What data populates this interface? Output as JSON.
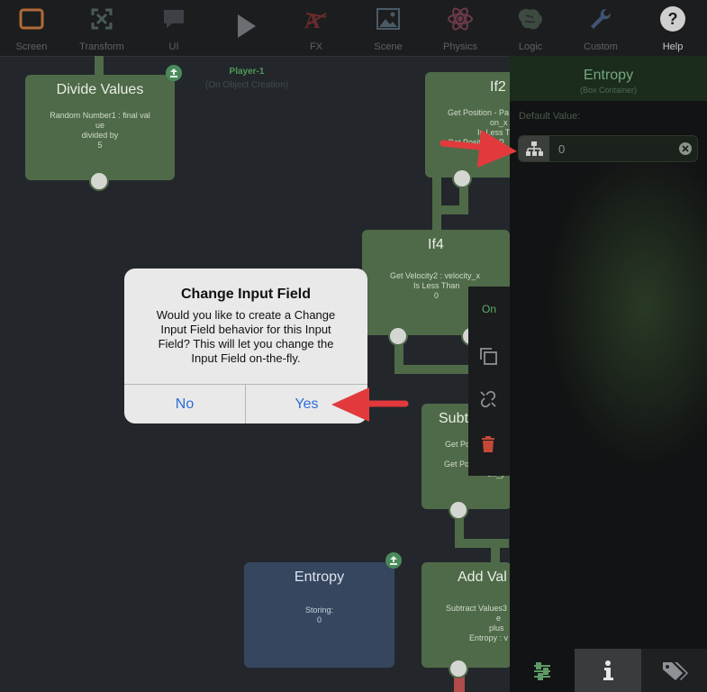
{
  "toolbar": {
    "items": [
      {
        "label": "Screen",
        "icon": "screen-icon"
      },
      {
        "label": "Transform",
        "icon": "transform-icon"
      },
      {
        "label": "UI",
        "icon": "ui-icon"
      },
      {
        "label": "",
        "icon": "play-icon"
      },
      {
        "label": "FX",
        "icon": "fx-icon"
      },
      {
        "label": "Scene",
        "icon": "scene-icon"
      },
      {
        "label": "Physics",
        "icon": "physics-icon"
      },
      {
        "label": "Logic",
        "icon": "logic-icon"
      },
      {
        "label": "Custom",
        "icon": "custom-icon"
      },
      {
        "label": "Help",
        "icon": "help-icon"
      }
    ]
  },
  "canvas": {
    "player": {
      "name": "Player-1",
      "event": "(On Object Creation)"
    },
    "nodes": {
      "divide": {
        "title": "Divide Values",
        "lines": [
          "Random Number1 : final val",
          "ue",
          "divided by",
          "5"
        ]
      },
      "if2": {
        "title": "If2",
        "lines": [
          "Get Position - Pa",
          "on_x",
          "Is Less T",
          "Get Position - P"
        ]
      },
      "if4": {
        "title": "If4",
        "lines": [
          "Get Velocity2 : velocity_x",
          "Is Less Than",
          "0"
        ]
      },
      "subtract": {
        "title": "Subt",
        "lines": [
          "Get Po",
          "",
          "Get Position - Pa",
          "on_y"
        ]
      },
      "add": {
        "title": "Add Val",
        "lines": [
          "Subtract Values3",
          "e",
          "plus",
          "Entropy : v"
        ]
      },
      "entropy": {
        "title": "Entropy",
        "lines": [
          "Storing:",
          "0"
        ]
      }
    }
  },
  "panel": {
    "title": "Entropy",
    "subtitle": "(Box Container)",
    "default_label": "Default Value:",
    "default_value": "0"
  },
  "sidemenu": {
    "on_label": "On"
  },
  "dialog": {
    "title": "Change Input Field",
    "message": "Would you like to create a Change Input Field behavior for this Input Field? This will let you change the Input Field on-the-fly.",
    "no_label": "No",
    "yes_label": "Yes"
  },
  "colors": {
    "node_green": "#4f6a48",
    "node_blue": "#36465f",
    "arrow_red": "#e23a3c",
    "link_blue": "#2c6bd6"
  }
}
